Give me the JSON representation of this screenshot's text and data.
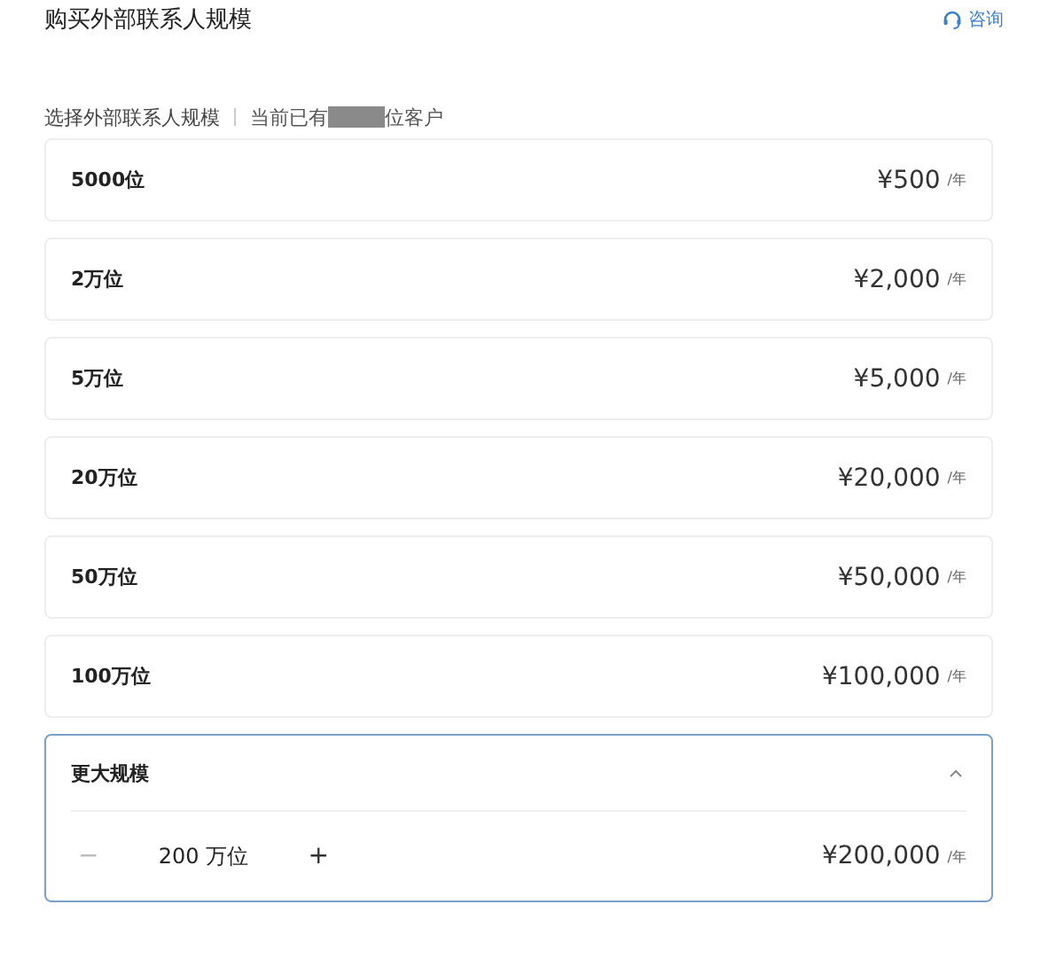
{
  "header": {
    "title": "购买外部联系人规模",
    "consult": "咨询"
  },
  "subtitle": {
    "label": "选择外部联系人规模",
    "current_prefix": "当前已有",
    "current_suffix": "位客户"
  },
  "plans": [
    {
      "name": "5000位",
      "price": "¥500",
      "unit": "/年",
      "selected": false
    },
    {
      "name": "2万位",
      "price": "¥2,000",
      "unit": "/年",
      "selected": false
    },
    {
      "name": "5万位",
      "price": "¥5,000",
      "unit": "/年",
      "selected": false
    },
    {
      "name": "20万位",
      "price": "¥20,000",
      "unit": "/年",
      "selected": false
    },
    {
      "name": "50万位",
      "price": "¥50,000",
      "unit": "/年",
      "selected": false
    },
    {
      "name": "100万位",
      "price": "¥100,000",
      "unit": "/年",
      "selected": false
    }
  ],
  "custom": {
    "name": "更大规模",
    "selected": true,
    "expanded": true,
    "minus": "−",
    "quantity": "200 万位",
    "plus": "+",
    "price": "¥200,000",
    "unit": "/年"
  }
}
